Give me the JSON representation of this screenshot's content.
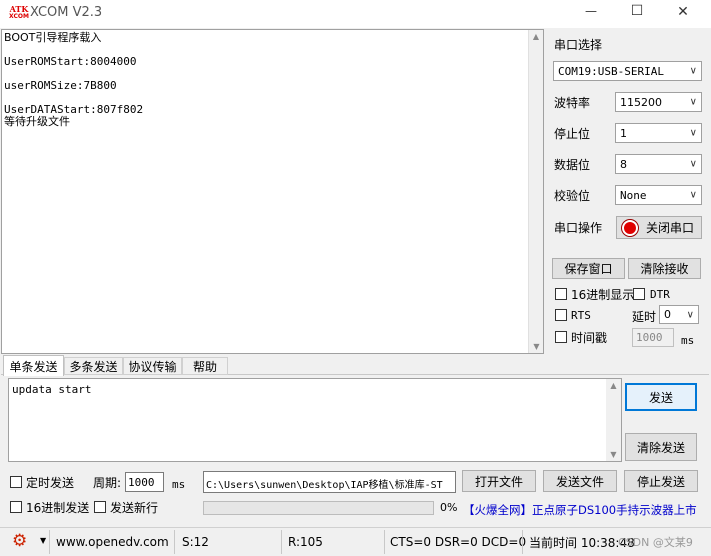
{
  "window": {
    "logo_top": "ATK",
    "logo_bottom": "XCOM",
    "title": "XCOM V2.3",
    "minimize": "—",
    "maximize": "☐",
    "close": "✕"
  },
  "receive": {
    "lines": [
      "BOOT引导程序载入",
      "",
      "UserROMStart:8004000",
      "",
      "userROMSize:7B800",
      "",
      "UserDATAStart:807f802",
      "等待升级文件"
    ]
  },
  "serial": {
    "group_label": "串口选择",
    "port": "COM19:USB-SERIAL",
    "baud_label": "波特率",
    "baud": "115200",
    "stop_label": "停止位",
    "stop": "1",
    "data_label": "数据位",
    "data": "8",
    "parity_label": "校验位",
    "parity": "None",
    "op_label": "串口操作",
    "op_button": "关闭串口"
  },
  "right_panel": {
    "save_window": "保存窗口",
    "clear_receive": "清除接收",
    "hex_display": "16进制显示",
    "dtr": "DTR",
    "rts": "RTS",
    "delay_label": "延时",
    "delay_value": "0",
    "timestamp": "时间戳",
    "timestamp_value": "1000",
    "ms": "ms"
  },
  "tabs": [
    "单条发送",
    "多条发送",
    "协议传输",
    "帮助"
  ],
  "send": {
    "text": "updata start",
    "send_button": "发送",
    "clear_send": "清除发送"
  },
  "bottom": {
    "timed_send": "定时发送",
    "period_label": "周期:",
    "period_value": "1000",
    "period_unit": "ms",
    "file_path": "C:\\Users\\sunwen\\Desktop\\IAP移植\\标准库-ST",
    "open_file": "打开文件",
    "send_file": "发送文件",
    "stop_send": "停止发送",
    "hex_send": "16进制发送",
    "send_newline": "发送新行",
    "progress_text": "0%",
    "progress": 0,
    "ad": "【火爆全网】正点原子DS100手持示波器上市"
  },
  "status": {
    "website": "www.openedv.com",
    "s": "S:12",
    "r": "R:105",
    "lines": "CTS=0 DSR=0 DCD=0",
    "time": "当前时间 10:38:48",
    "watermark": "CSDN @文某9"
  },
  "colors": {
    "accent": "#0078d7",
    "ad_text": "#0000cc",
    "led_red": "#e00000",
    "gear": "#cc2200"
  }
}
